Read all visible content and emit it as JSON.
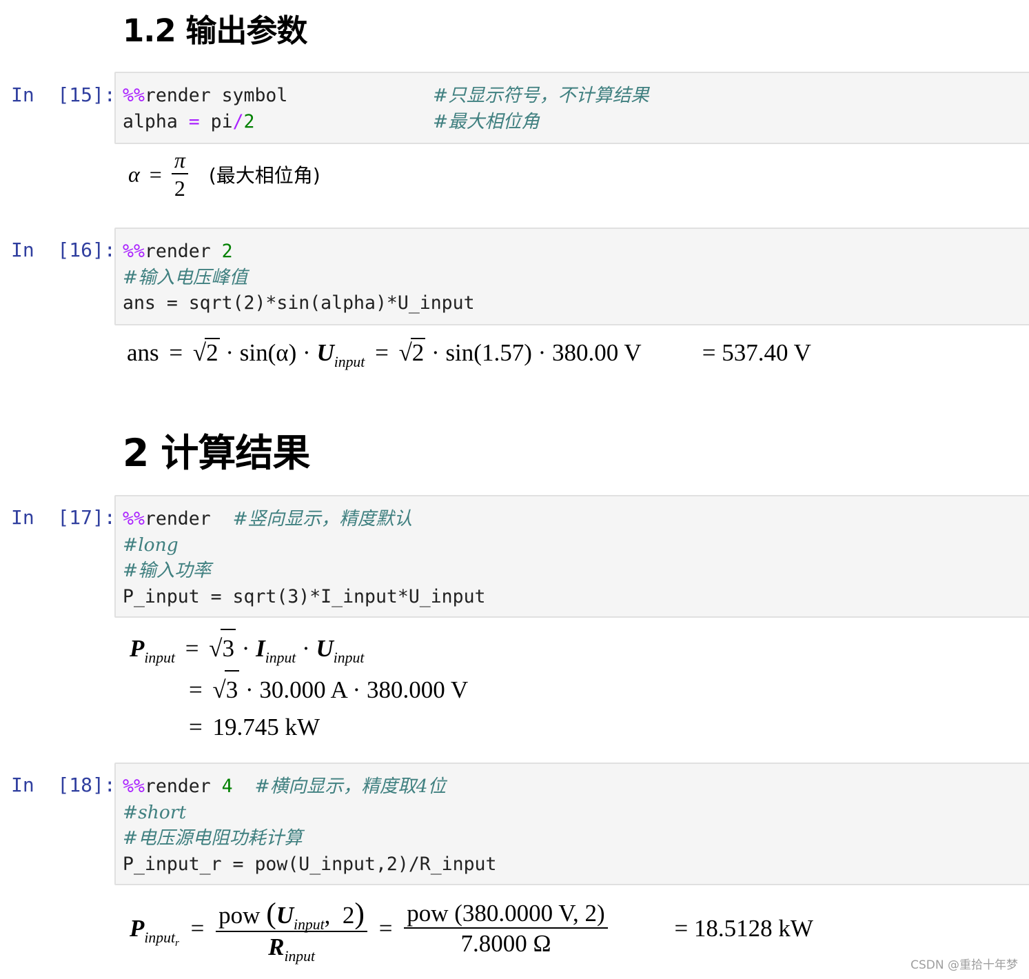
{
  "headings": {
    "h1": "1.2 输出参数",
    "h2": "2 计算结果"
  },
  "cells": [
    {
      "prompt": "In  [15]:",
      "code": {
        "l1_magic": "%%",
        "l1_cmd": "render symbol",
        "l1_comment": "#只显示符号，不计算结果",
        "l2_a": "alpha ",
        "l2_eq": "=",
        "l2_b": " pi",
        "l2_op": "/",
        "l2_num": "2",
        "l2_comment": "#最大相位角"
      },
      "output": {
        "lhs": "α",
        "eq": "=",
        "num": "π",
        "den": "2",
        "note": "(最大相位角)"
      }
    },
    {
      "prompt": "In  [16]:",
      "code": {
        "l1_magic": "%%",
        "l1_cmd": "render ",
        "l1_num": "2",
        "l2_comment": "#输入电压峰值",
        "l3": "ans = sqrt(2)*sin(alpha)*U_input"
      },
      "output": {
        "lhs": "ans",
        "eq": "=",
        "sqrt_arg": "2",
        "dot": "·",
        "sin_sym": "sin(α)",
        "U": "U",
        "U_sub": "input",
        "sin_val": "sin(1.57)",
        "u_val": "380.00 V",
        "result": "= 537.40 V"
      }
    },
    {
      "prompt": "In  [17]:",
      "code": {
        "l1_magic": "%%",
        "l1_cmd": "render  ",
        "l1_comment": "#竖向显示，精度默认",
        "l2_comment": "#long",
        "l3_comment": "#输入功率",
        "l4": "P_input = sqrt(3)*I_input*U_input"
      },
      "output": {
        "P": "P",
        "P_sub": "input",
        "eq": "=",
        "sqrt_arg": "3",
        "I": "I",
        "I_sub": "input",
        "U": "U",
        "U_sub": "input",
        "i_val": "30.000 A",
        "u_val": "380.000 V",
        "result": "19.745 kW"
      }
    },
    {
      "prompt": "In  [18]:",
      "code": {
        "l1_magic": "%%",
        "l1_cmd": "render ",
        "l1_num": "4",
        "l1_comment": "#横向显示，精度取4位",
        "l2_comment": "#short",
        "l3_comment": "#电压源电阻功耗计算",
        "l4": "P_input_r = pow(U_input,2)/R_input"
      },
      "output": {
        "P": "P",
        "P_sub": "input",
        "P_subsub": "r",
        "eq": "=",
        "pow": "pow",
        "U": "U",
        "U_sub": "input",
        "two": "2",
        "R": "R",
        "R_sub": "input",
        "num_val": "pow (380.0000 V,  2)",
        "den_val": "7.8000 Ω",
        "result": "= 18.5128 kW"
      }
    }
  ],
  "watermark": "CSDN @重拾十年梦"
}
